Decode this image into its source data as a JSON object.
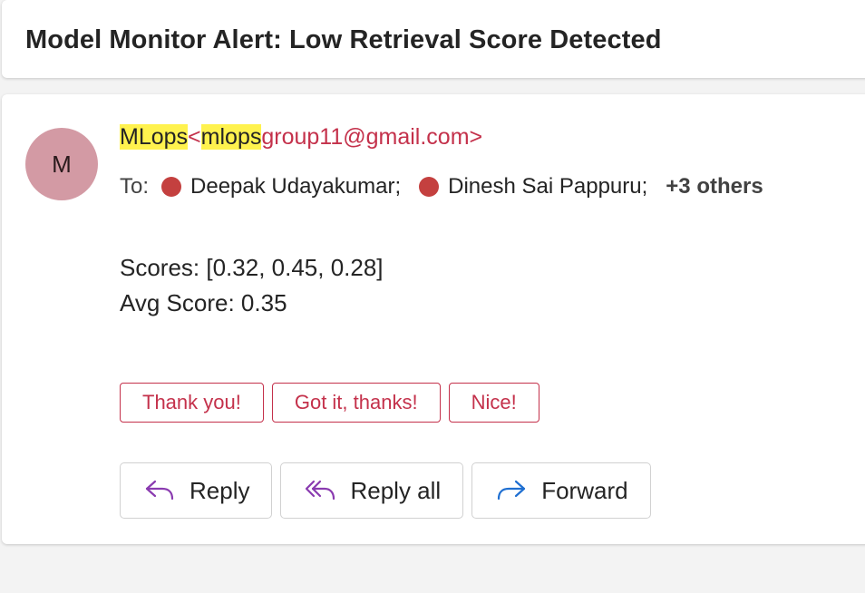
{
  "subject": "Model Monitor Alert: Low Retrieval Score Detected",
  "sender": {
    "avatar_initial": "M",
    "name": "MLops",
    "email_open": "<",
    "email_highlight": "mlops",
    "email_rest": "group11@gmail.com>",
    "highlight_color": "#fff24e"
  },
  "to": {
    "label": "To:",
    "recipients": [
      "Deepak Udayakumar;",
      "Dinesh Sai Pappuru;"
    ],
    "others": "+3 others"
  },
  "body": {
    "line1": "Scores: [0.32, 0.45, 0.28]",
    "line2": "Avg Score: 0.35"
  },
  "quick_replies": [
    "Thank you!",
    "Got it, thanks!",
    "Nice!"
  ],
  "actions": {
    "reply": "Reply",
    "reply_all": "Reply all",
    "forward": "Forward"
  },
  "colors": {
    "accent": "#c4314b",
    "presence_dot": "#c4403f",
    "avatar_bg": "#d39aa4",
    "reply_icon": "#8a3bb0",
    "forward_icon": "#1f6fd1"
  }
}
